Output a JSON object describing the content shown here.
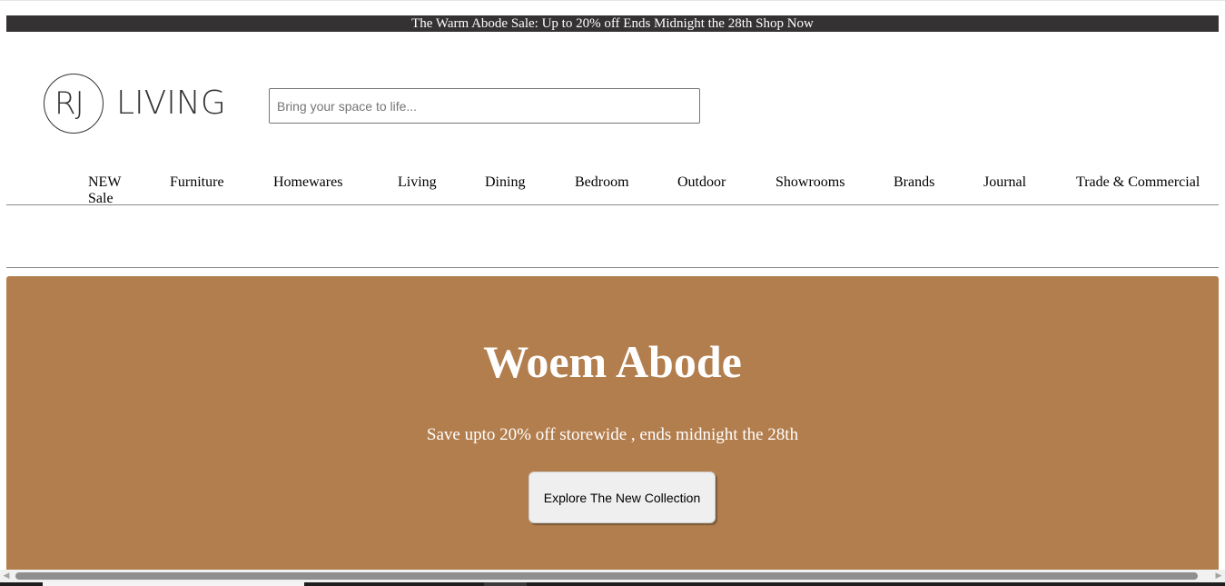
{
  "promo": {
    "text": "The Warm Abode Sale: Up to 20% off Ends Midnight the 28th Shop Now"
  },
  "logo": {
    "rj": "RJ",
    "living": "LIVING"
  },
  "search": {
    "placeholder": "Bring your space to life...",
    "value": ""
  },
  "nav": {
    "items": [
      {
        "label": "NEW Sale"
      },
      {
        "label": "Furniture"
      },
      {
        "label": "Homewares"
      },
      {
        "label": "Living"
      },
      {
        "label": "Dining"
      },
      {
        "label": "Bedroom"
      },
      {
        "label": "Outdoor"
      },
      {
        "label": "Showrooms"
      },
      {
        "label": "Brands"
      },
      {
        "label": "Journal"
      },
      {
        "label": "Trade & Commercial"
      }
    ]
  },
  "hero": {
    "title": "Woem Abode",
    "subtitle": "Save upto 20% off storewide , ends midnight the 28th",
    "button_label": "Explore The New Collection",
    "background_color": "#b37e4e"
  },
  "scrollbar": {
    "left_icon": "arrow-left-icon",
    "right_icon": "arrow-right-icon"
  }
}
